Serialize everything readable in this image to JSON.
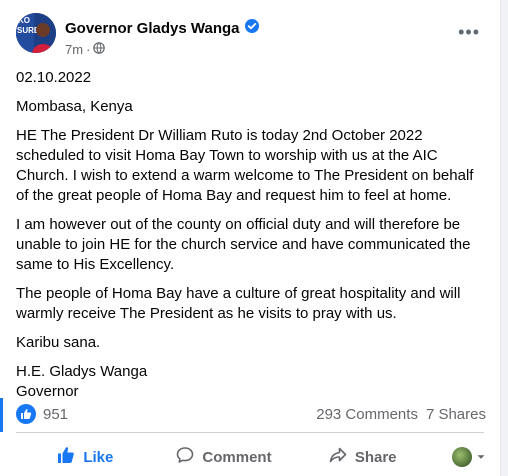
{
  "post": {
    "author": "Governor Gladys Wanga",
    "time": "7m",
    "avatar_badge": "SURE!",
    "avatar_badge_top": "KO",
    "date_line": "02.10.2022",
    "location": "Mombasa, Kenya",
    "paragraphs": [
      "HE The President Dr William Ruto is today 2nd October 2022 scheduled to visit Homa Bay Town to worship with us at the AIC Church. I wish to extend a warm welcome to The President on behalf of the great people of Homa Bay and request him to feel at home.",
      "I am however out of the county on official duty and will therefore be unable to join HE for the church service and have communicated the same to His Excellency.",
      "The people of Homa Bay have a culture of great hospitality and will warmly receive The President as he visits to pray with us.",
      "Karibu sana."
    ],
    "signature_name": "H.E. Gladys Wanga",
    "signature_title": "Governor"
  },
  "stats": {
    "likes": "951",
    "comments": "293 Comments",
    "shares": "7 Shares"
  },
  "actions": {
    "like": "Like",
    "comment": "Comment",
    "share": "Share"
  },
  "colors": {
    "accent": "#1877f2",
    "muted": "#65676b"
  }
}
